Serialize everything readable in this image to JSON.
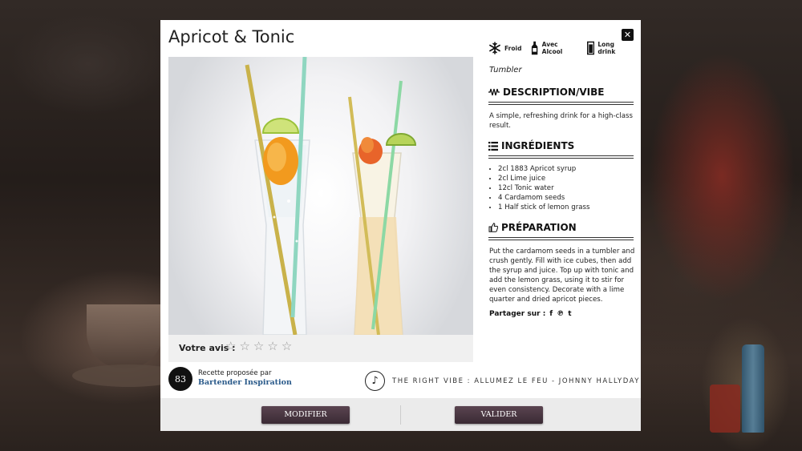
{
  "recipe": {
    "title": "Apricot & Tonic",
    "close_label": "✕"
  },
  "attributes": [
    {
      "icon": "snowflake-icon",
      "label": "Froid"
    },
    {
      "icon": "bottle-icon",
      "label": "Avec Alcool"
    },
    {
      "icon": "tall-glass-icon",
      "label": "Long drink"
    }
  ],
  "glass_type": "Tumbler",
  "description": {
    "heading": "DESCRIPTION/VIBE",
    "text": "A simple, refreshing drink for a high-class result."
  },
  "ingredients": {
    "heading": "INGRÉDIENTS",
    "items": [
      "2cl 1883 Apricot syrup",
      "2cl Lime juice",
      "12cl Tonic water",
      "4 Cardamom seeds",
      "1 Half stick of lemon grass"
    ]
  },
  "preparation": {
    "heading": "PRÉPARATION",
    "text": "Put the cardamom seeds in a tumbler and crush gently. Fill with ice cubes, then add the syrup and juice. Top up with tonic and add the lemon grass, using it to stir for even consistency. Decorate with a lime quarter and dried apricot pieces."
  },
  "share": {
    "label": "Partager sur :",
    "networks": [
      "f",
      "℗",
      "t"
    ]
  },
  "rating": {
    "label": "Votre avis :",
    "stars": [
      "☆",
      "☆",
      "☆",
      "☆",
      "☆"
    ],
    "value": 0
  },
  "proposer": {
    "label": "Recette proposée par",
    "name": "Bartender Inspiration",
    "badge_text": "83"
  },
  "vibe": {
    "text": "THE RIGHT VIBE : ALLUMEZ LE FEU - JOHNNY HALLYDAY"
  },
  "footer": {
    "modify_label": "MODIFIER",
    "validate_label": "VALIDER"
  },
  "colors": {
    "button": "#4a3642",
    "brand_link": "#2a5a8a"
  }
}
